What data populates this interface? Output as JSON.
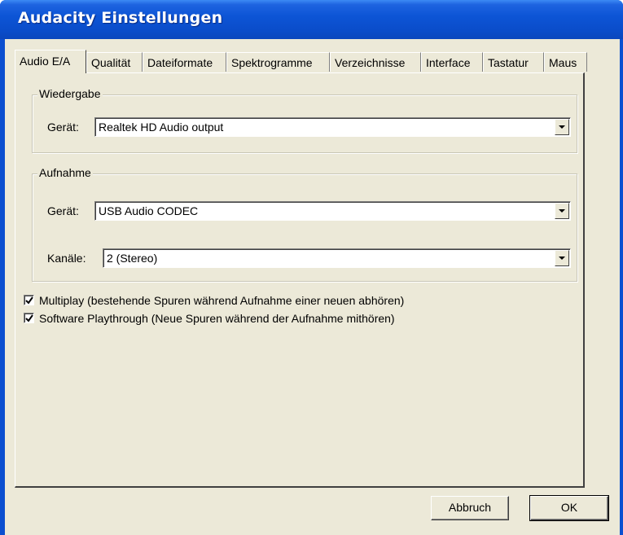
{
  "window": {
    "title": "Audacity Einstellungen"
  },
  "tabs": [
    {
      "label": "Audio E/A",
      "active": true
    },
    {
      "label": "Qualität",
      "active": false
    },
    {
      "label": "Dateiformate",
      "active": false
    },
    {
      "label": "Spektrogramme",
      "active": false
    },
    {
      "label": "Verzeichnisse",
      "active": false
    },
    {
      "label": "Interface",
      "active": false
    },
    {
      "label": "Tastatur",
      "active": false
    },
    {
      "label": "Maus",
      "active": false
    }
  ],
  "playback": {
    "group_label": "Wiedergabe",
    "device_label": "Gerät:",
    "device_value": "Realtek HD Audio output"
  },
  "recording": {
    "group_label": "Aufnahme",
    "device_label": "Gerät:",
    "device_value": "USB Audio CODEC",
    "channels_label": "Kanäle:",
    "channels_value": "2 (Stereo)"
  },
  "options": [
    {
      "label": "Multiplay (bestehende Spuren während Aufnahme einer neuen abhören)",
      "checked": true
    },
    {
      "label": "Software Playthrough (Neue Spuren während der Aufnahme mithören)",
      "checked": true
    }
  ],
  "buttons": {
    "cancel_label": "Abbruch",
    "ok_label": "OK"
  },
  "icons": {
    "combo_arrow": "chevron-down-icon",
    "check": "checkmark-icon"
  }
}
